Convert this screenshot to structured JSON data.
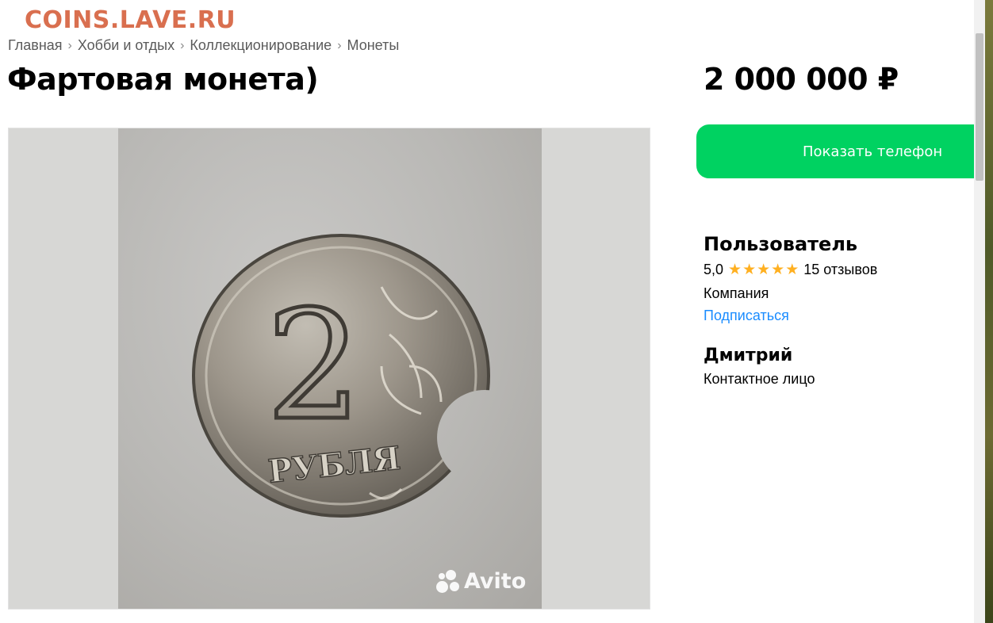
{
  "watermark": "COINS.LAVE.RU",
  "breadcrumb": [
    "Главная",
    "Хобби и отдых",
    "Коллекционирование",
    "Монеты"
  ],
  "title": "Фартовая монета)",
  "price": "2 000 000 ₽",
  "actions": {
    "show_phone": "Показать телефон"
  },
  "seller": {
    "name": "Пользователь",
    "rating": "5,0",
    "stars": 5,
    "reviews": "15 отзывов",
    "type": "Компания",
    "subscribe": "Подписаться"
  },
  "contact": {
    "name": "Дмитрий",
    "role": "Контактное лицо"
  },
  "photo": {
    "coin_denomination": "2",
    "coin_text": "РУБЛЯ",
    "brand": "Avito"
  },
  "colors": {
    "accent": "#00d261",
    "link": "#1a8cff",
    "star": "#ffb021",
    "watermark": "#d96f4f"
  }
}
